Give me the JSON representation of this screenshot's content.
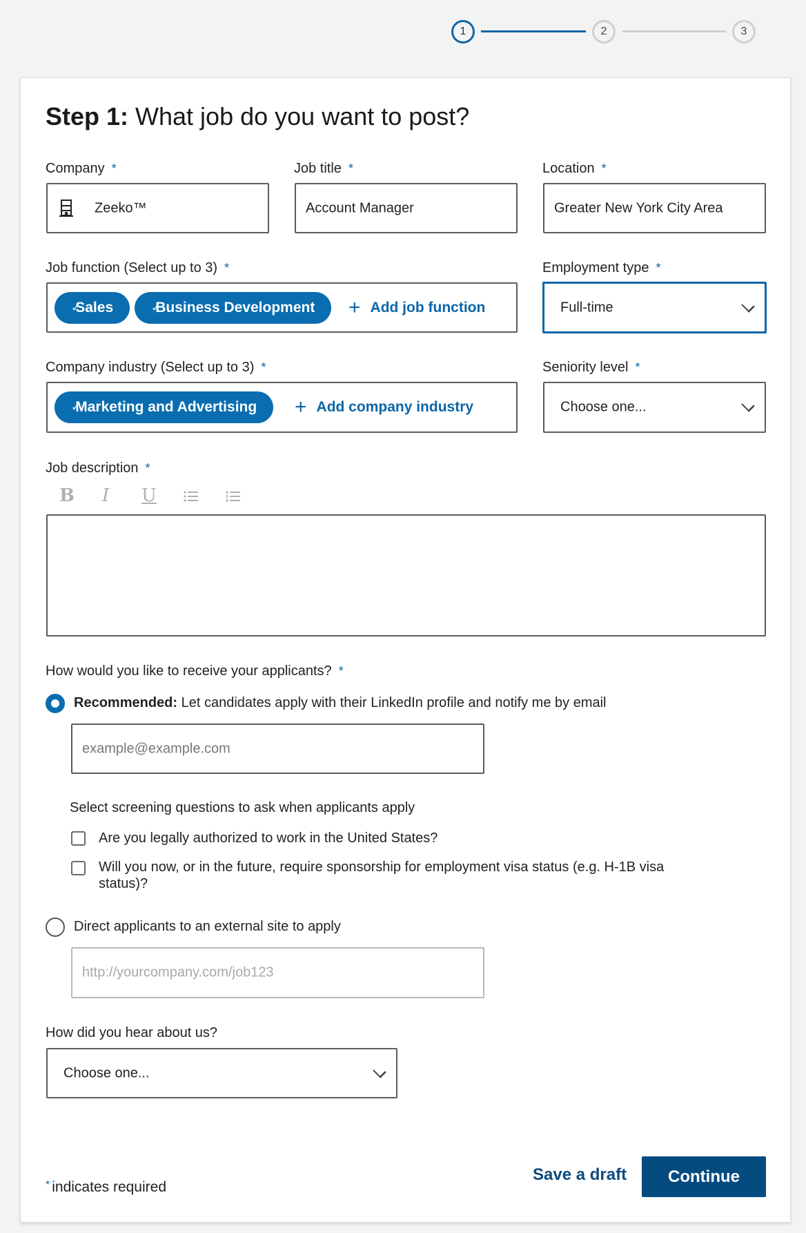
{
  "stepper": {
    "steps": [
      {
        "label": "1",
        "state": "active"
      },
      {
        "label": "2",
        "state": "inactive"
      },
      {
        "label": "3",
        "state": "inactive"
      }
    ],
    "current_step": 1,
    "total_steps": 3
  },
  "header": {
    "title_bold": "Step 1:",
    "title_rest": " What job do you want to post?"
  },
  "required_marker": "*",
  "fields": {
    "company": {
      "label": "Company",
      "value": "Zeeko™",
      "icon": "building-icon"
    },
    "job_title": {
      "label": "Job title",
      "value": "Account Manager"
    },
    "location": {
      "label": "Location",
      "value": "Greater New York City Area"
    },
    "job_function": {
      "label": "Job function (Select up to 3)",
      "selected": [
        "Sales",
        "Business Development"
      ],
      "add_label": "Add job function"
    },
    "employment_type": {
      "label": "Employment type",
      "value": "Full-time"
    },
    "company_industry": {
      "label": "Company industry (Select up to 3)",
      "selected": [
        "Marketing and Advertising"
      ],
      "add_label": "Add company industry"
    },
    "seniority_level": {
      "label": "Seniority level",
      "value": "Choose one..."
    },
    "job_description": {
      "label": "Job description",
      "toolbar": [
        {
          "name": "bold",
          "glyph": "B"
        },
        {
          "name": "italic",
          "glyph": "I"
        },
        {
          "name": "underline",
          "glyph": "U"
        },
        {
          "name": "bulleted-list",
          "glyph": "⁝☰"
        },
        {
          "name": "numbered-list",
          "glyph": "⋮☰"
        }
      ],
      "value": ""
    }
  },
  "applicants": {
    "label": "How would you like to receive your applicants?",
    "option_recommended": {
      "bold": "Recommended:",
      "text": " Let candidates apply with their LinkedIn profile and notify me by email",
      "selected": true,
      "email_placeholder": "example@example.com"
    },
    "screening": {
      "label": "Select screening questions to ask when applicants apply",
      "questions": [
        {
          "text": "Are you legally authorized to work in the United States?",
          "checked": false
        },
        {
          "text_line1": "Will you now, or in the future, require sponsorship for employment visa status (e.g. H-1B visa",
          "text_line2": "status)?",
          "checked": false
        }
      ]
    },
    "option_external": {
      "text": "Direct applicants to an external site to apply",
      "selected": false,
      "url_placeholder": "http://yourcompany.com/job123"
    }
  },
  "hear_about": {
    "label": "How did you hear about us?",
    "value": "Choose one..."
  },
  "footer": {
    "required_note": "indicates required",
    "save_draft": "Save a draft",
    "continue": "Continue"
  },
  "colors": {
    "accent": "#0a66a8",
    "pill": "#0a6db0",
    "primary_button": "#064b80",
    "save_draft_text": "#0d4a7e"
  }
}
